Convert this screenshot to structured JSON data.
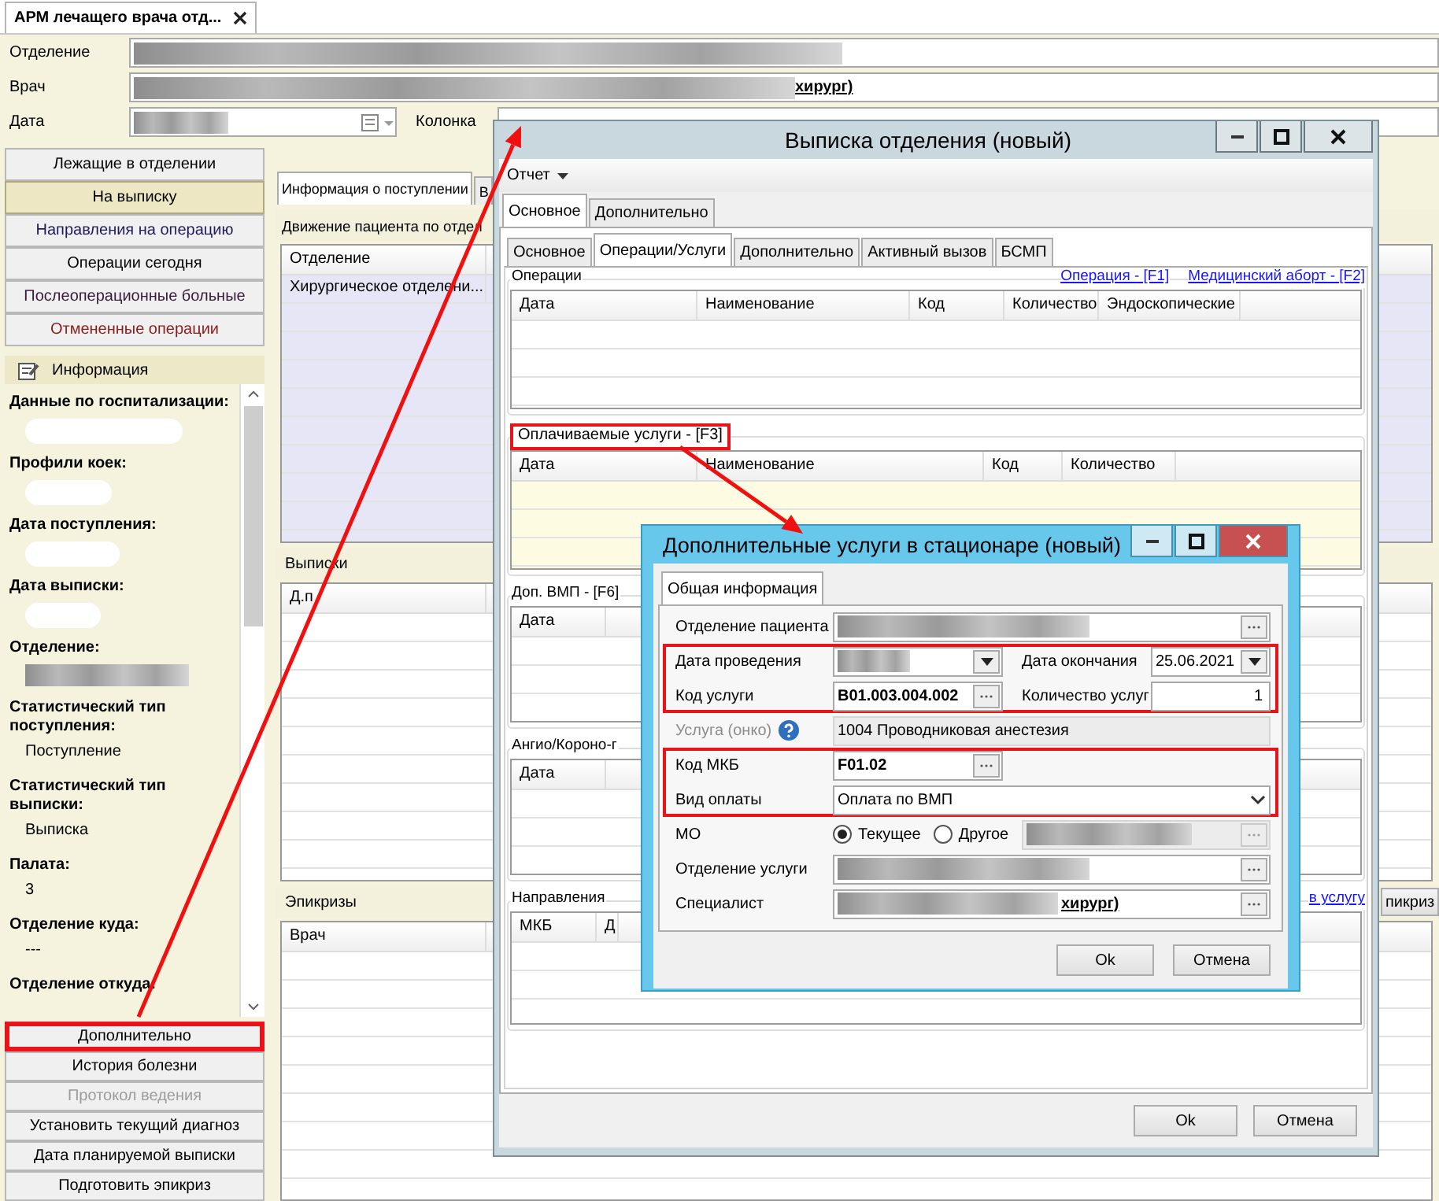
{
  "app_tab": {
    "title": "АРМ лечащего врача отд..."
  },
  "filters": [
    {
      "label": "Отделение",
      "kind": "text",
      "redacted": true
    },
    {
      "label": "Врач",
      "kind": "text",
      "redacted": true,
      "value": "хирург)"
    },
    {
      "label": "Дата",
      "kind": "date",
      "redacted": true
    }
  ],
  "column_filter": {
    "label": "Колонка"
  },
  "nav": [
    {
      "label": "Лежащие в отделении",
      "selected": false,
      "color": "#000000"
    },
    {
      "label": "На выписку",
      "selected": true,
      "color": "#000000"
    },
    {
      "label": "Направления на операцию",
      "selected": false,
      "color": "#1f1a5a"
    },
    {
      "label": "Операции сегодня",
      "selected": false,
      "color": "#000000"
    },
    {
      "label": "Послеоперационные больные",
      "selected": false,
      "color": "#3a1a3a"
    },
    {
      "label": "Отмененные операции",
      "selected": false,
      "color": "#8b1a1a"
    }
  ],
  "info": {
    "title": "Информация",
    "fields": [
      {
        "label": "Данные по госпитализации:",
        "kind": "blank"
      },
      {
        "label": "Профили коек:",
        "kind": "blank"
      },
      {
        "label": "Дата поступления:",
        "kind": "blank"
      },
      {
        "label": "Дата выписки:",
        "kind": "blank"
      },
      {
        "label": "Отделение:",
        "kind": "blurred"
      },
      {
        "label": "Статистический тип поступления:",
        "kind": "text",
        "value": "Поступление"
      },
      {
        "label": "Статистический тип выписки:",
        "kind": "text",
        "value": "Выписка"
      },
      {
        "label": "Палата:",
        "kind": "text",
        "value": "3"
      },
      {
        "label": "Отделение куда:",
        "kind": "text",
        "value": "---"
      },
      {
        "label": "Отделение откуда:",
        "kind": "none"
      }
    ]
  },
  "actions": [
    {
      "label": "Дополнительно",
      "disabled": false,
      "highlighted": true
    },
    {
      "label": "История болезни",
      "disabled": false,
      "highlighted": false
    },
    {
      "label": "Протокол ведения",
      "disabled": true,
      "highlighted": false
    },
    {
      "label": "Установить текущий диагноз",
      "disabled": false,
      "highlighted": false
    },
    {
      "label": "Дата планируемой выписки",
      "disabled": false,
      "highlighted": false
    },
    {
      "label": "Подготовить эпикриз",
      "disabled": false,
      "highlighted": false
    }
  ],
  "main": {
    "tabs": [
      {
        "label": "Информация о поступлении",
        "selected": true
      },
      {
        "label": "В",
        "selected": false
      }
    ],
    "movement": {
      "title": "Движение пациента по отдел",
      "columns": [
        "Отделение"
      ],
      "rows": [
        [
          "Хирургическое отделени..."
        ]
      ]
    },
    "discharges": {
      "title": "Выписки",
      "columns": [
        "Д.п"
      ]
    },
    "epicrises": {
      "title": "Эпикризы",
      "columns": [
        "Врач"
      ],
      "button": "пикриз"
    }
  },
  "discharge_dialog": {
    "title": "Выписка отделения (новый)",
    "menu": "Отчет",
    "tabs": [
      {
        "label": "Основное",
        "selected": true
      },
      {
        "label": "Дополнительно",
        "selected": false
      }
    ],
    "subtabs": [
      {
        "label": "Основное",
        "selected": false
      },
      {
        "label": "Операции/Услуги",
        "selected": true
      },
      {
        "label": "Дополнительно",
        "selected": false
      },
      {
        "label": "Активный вызов",
        "selected": false
      },
      {
        "label": "БСМП",
        "selected": false
      }
    ],
    "groups": [
      {
        "title": "Операции",
        "highlighted": false,
        "links": [
          "Операция - [F1]",
          "Медицинский аборт - [F2]"
        ],
        "columns": [
          "Дата",
          "Наименование",
          "Код",
          "Количество",
          "Эндоскопические"
        ],
        "shaded": false
      },
      {
        "title": "Оплачиваемые услуги - [F3]",
        "highlighted": true,
        "columns": [
          "Дата",
          "Наименование",
          "Код",
          "Количество"
        ],
        "shaded": true
      },
      {
        "title": "Доп. ВМП - [F6]",
        "highlighted": false,
        "columns": [
          "Дата"
        ],
        "shaded": false
      },
      {
        "title": "Ангио/Короно-г",
        "highlighted": false,
        "columns": [
          "Дата"
        ],
        "shaded": false
      },
      {
        "title": "Направления",
        "highlighted": false,
        "links": [
          "в услугу"
        ],
        "columns": [
          "МКБ",
          "Д"
        ],
        "shaded": false
      }
    ],
    "buttons": [
      "Ok",
      "Отмена"
    ]
  },
  "services_dialog": {
    "title": "Дополнительные услуги в стационаре (новый)",
    "tabs": [
      {
        "label": "Общая информация",
        "selected": true
      }
    ],
    "sections": [
      {
        "highlighted": false,
        "rows": [
          [
            {
              "label": "Отделение пациента",
              "kind": "lookup",
              "redacted": true
            }
          ]
        ]
      },
      {
        "highlighted": true,
        "rows": [
          [
            {
              "label": "Дата проведения",
              "kind": "date",
              "redacted": true
            },
            {
              "label": "Дата окончания",
              "kind": "date",
              "value": "25.06.2021"
            }
          ],
          [
            {
              "label": "Код услуги",
              "kind": "code",
              "value": "B01.003.004.002",
              "bold": true
            },
            {
              "label": "Количество услуг",
              "kind": "number",
              "value": "1"
            }
          ]
        ]
      },
      {
        "highlighted": false,
        "rows": [
          [
            {
              "label": "Услуга (онко)",
              "kind": "readonly",
              "disabled": true,
              "help": true,
              "value": "1004 Проводниковая анестезия"
            }
          ]
        ]
      },
      {
        "highlighted": true,
        "rows": [
          [
            {
              "label": "Код МКБ",
              "kind": "code",
              "value": "F01.02",
              "bold": true
            }
          ],
          [
            {
              "label": "Вид оплаты",
              "kind": "select",
              "value": "Оплата по ВМП"
            }
          ]
        ]
      },
      {
        "highlighted": false,
        "rows": [
          [
            {
              "label": "МО",
              "kind": "radio",
              "redacted": true,
              "options": [
                {
                  "label": "Текущее",
                  "selected": true
                },
                {
                  "label": "Другое",
                  "selected": false
                }
              ]
            }
          ],
          [
            {
              "label": "Отделение услуги",
              "kind": "lookup",
              "redacted": true
            }
          ],
          [
            {
              "label": "Специалист",
              "kind": "lookup",
              "redacted": true,
              "value": "хирург)"
            }
          ]
        ]
      }
    ],
    "buttons": [
      "Ok",
      "Отмена"
    ]
  }
}
